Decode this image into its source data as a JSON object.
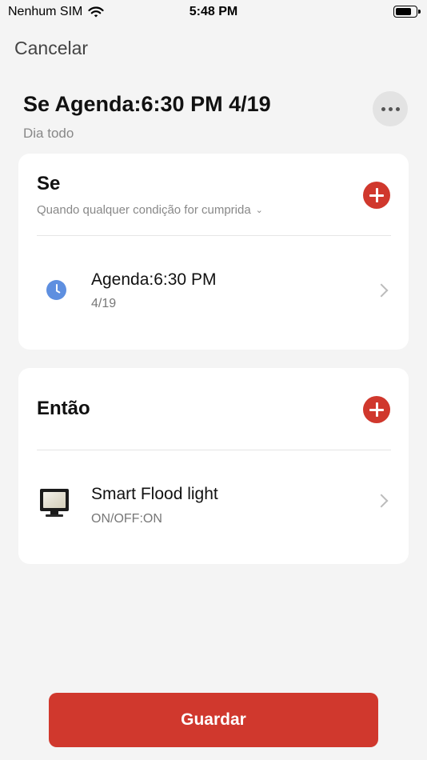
{
  "status_bar": {
    "carrier": "Nenhum SIM",
    "time": "5:48 PM"
  },
  "header": {
    "cancel_label": "Cancelar",
    "title": "Se Agenda:6:30 PM 4/19",
    "subtitle": "Dia todo"
  },
  "if_section": {
    "title": "Se",
    "subtitle": "Quando qualquer condição for cumprida",
    "items": [
      {
        "icon": "clock-icon",
        "title": "Agenda:6:30 PM",
        "subtitle": "4/19"
      }
    ]
  },
  "then_section": {
    "title": "Então",
    "items": [
      {
        "icon": "flood-light-icon",
        "title": "Smart Flood light",
        "subtitle": "ON/OFF:ON"
      }
    ]
  },
  "footer": {
    "save_label": "Guardar"
  },
  "colors": {
    "accent": "#d0382d",
    "background": "#f4f4f4",
    "clock_icon": "#5e8fe0"
  }
}
